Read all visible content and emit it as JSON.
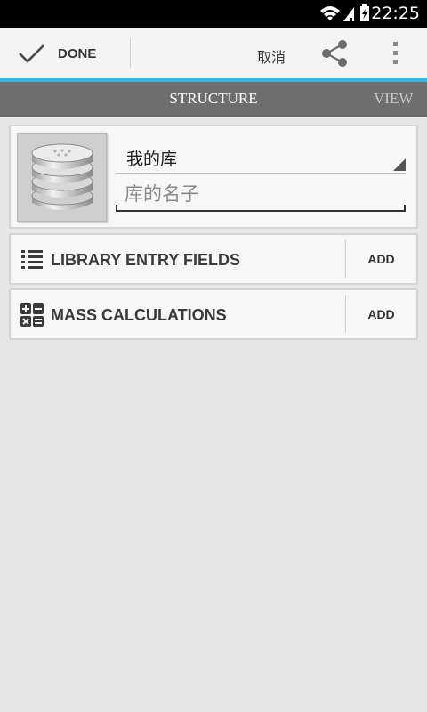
{
  "status_bar": {
    "time": "22:25",
    "icons": [
      "wifi-icon",
      "signal-icon",
      "battery-charging-icon"
    ]
  },
  "action_bar": {
    "done_label": "DONE",
    "cancel_label": "取消",
    "icons": [
      "check-icon",
      "share-icon",
      "overflow-menu-icon"
    ],
    "accent_color": "#33b5e5"
  },
  "tabs": {
    "structure": "STRUCTURE",
    "view": "VIEW"
  },
  "library": {
    "icon": "database-icon",
    "selector_value": "我的库",
    "name_placeholder": "库的名子",
    "name_value": ""
  },
  "sections": {
    "entry_fields": {
      "label": "LIBRARY ENTRY FIELDS",
      "add_label": "ADD",
      "icon": "list-icon"
    },
    "mass_calculations": {
      "label": "MASS CALCULATIONS",
      "add_label": "ADD",
      "icon": "calculator-icon"
    }
  }
}
